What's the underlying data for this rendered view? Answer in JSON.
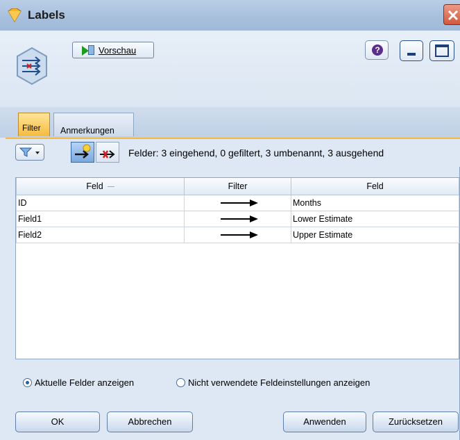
{
  "window": {
    "title": "Labels"
  },
  "header": {
    "preview_label": "Vorschau"
  },
  "tabs": [
    {
      "label": "Filter",
      "active": true
    },
    {
      "label": "Anmerkungen",
      "active": false
    }
  ],
  "toolbar": {
    "stats_text": "Felder: 3 eingehend, 0 gefiltert, 3 umbenannt, 3 ausgehend"
  },
  "table": {
    "headers": [
      "Feld",
      "Filter",
      "Feld"
    ],
    "rows": [
      {
        "field": "ID",
        "new_field": "Months"
      },
      {
        "field": "Field1",
        "new_field": "Lower Estimate"
      },
      {
        "field": "Field2",
        "new_field": "Upper Estimate"
      }
    ]
  },
  "options": {
    "radio_current": "Aktuelle Felder anzeigen",
    "radio_unused": "Nicht verwendete Feldeinstellungen anzeigen",
    "selected": "radio_current"
  },
  "buttons": {
    "ok": "OK",
    "cancel": "Abbrechen",
    "apply": "Anwenden",
    "reset": "Zurücksetzen"
  },
  "colors": {
    "accent_tab": "#f6bb3e",
    "window_bg": "#dde8f4",
    "title_bar": "#a7bfdd"
  }
}
